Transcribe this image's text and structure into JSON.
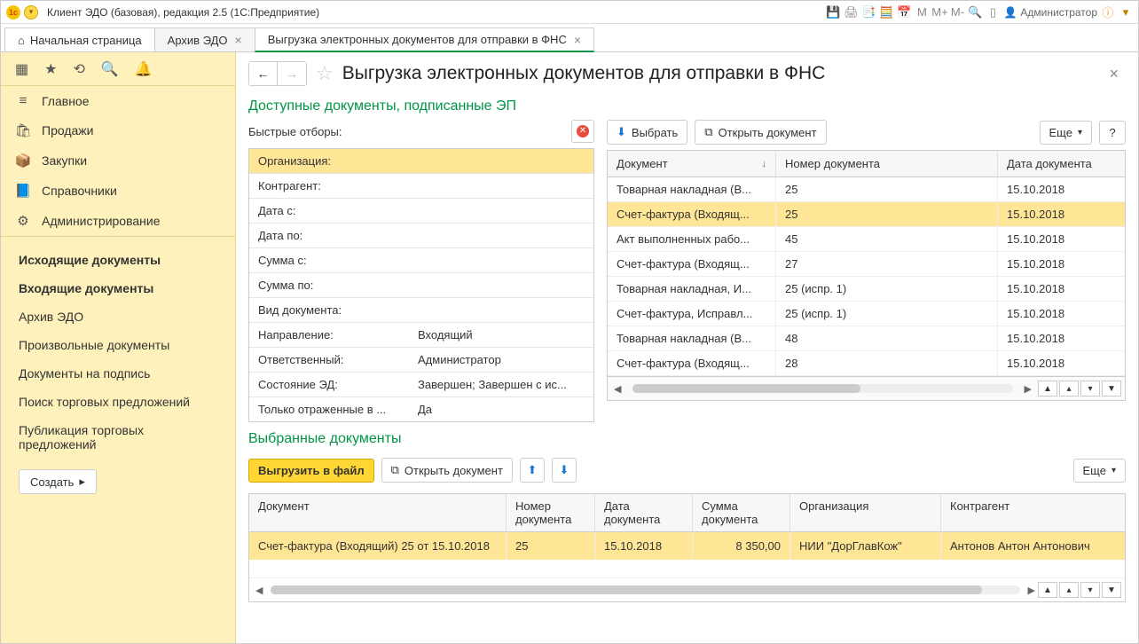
{
  "titlebar": {
    "app_label": "Клиент ЭДО (базовая), редакция 2.5  (1С:Предприятие)",
    "user": "Администратор",
    "m_buttons": [
      "M",
      "M+",
      "M-"
    ]
  },
  "tabs": {
    "home": "Начальная страница",
    "archive": "Архив ЭДО",
    "export": "Выгрузка электронных документов для отправки в ФНС"
  },
  "sidebar": {
    "main": "Главное",
    "sales": "Продажи",
    "purchases": "Закупки",
    "refs": "Справочники",
    "admin": "Администрирование",
    "links": {
      "outgoing": "Исходящие документы",
      "incoming": "Входящие документы",
      "archive": "Архив ЭДО",
      "arbitrary": "Произвольные документы",
      "tosign": "Документы на подпись",
      "search_offers": "Поиск торговых предложений",
      "publish_offers": "Публикация торговых предложений"
    },
    "create": "Создать"
  },
  "page": {
    "title": "Выгрузка электронных документов для отправки в ФНС"
  },
  "available": {
    "title": "Доступные документы, подписанные ЭП",
    "filters_label": "Быстрые отборы:",
    "filters": [
      {
        "label": "Организация:",
        "value": "",
        "selected": true
      },
      {
        "label": "Контрагент:",
        "value": ""
      },
      {
        "label": "Дата с:",
        "value": ""
      },
      {
        "label": "Дата по:",
        "value": ""
      },
      {
        "label": "Сумма с:",
        "value": ""
      },
      {
        "label": "Сумма по:",
        "value": ""
      },
      {
        "label": "Вид документа:",
        "value": ""
      },
      {
        "label": "Направление:",
        "value": "Входящий"
      },
      {
        "label": "Ответственный:",
        "value": "Администратор"
      },
      {
        "label": "Состояние ЭД:",
        "value": "Завершен; Завершен с ис..."
      },
      {
        "label": "Только отраженные в ...",
        "value": "Да"
      }
    ],
    "toolbar": {
      "select": "Выбрать",
      "open": "Открыть документ",
      "more": "Еще",
      "help": "?"
    },
    "columns": {
      "doc": "Документ",
      "num": "Номер документа",
      "date": "Дата документа"
    },
    "rows": [
      {
        "doc": "Товарная накладная (В...",
        "num": "25",
        "date": "15.10.2018"
      },
      {
        "doc": "Счет-фактура (Входящ...",
        "num": "25",
        "date": "15.10.2018",
        "selected": true
      },
      {
        "doc": "Акт выполненных рабо...",
        "num": "45",
        "date": "15.10.2018"
      },
      {
        "doc": "Счет-фактура (Входящ...",
        "num": "27",
        "date": "15.10.2018"
      },
      {
        "doc": "Товарная накладная, И...",
        "num": "25 (испр. 1)",
        "date": "15.10.2018"
      },
      {
        "doc": "Счет-фактура, Исправл...",
        "num": "25 (испр. 1)",
        "date": "15.10.2018"
      },
      {
        "doc": "Товарная накладная (В...",
        "num": "48",
        "date": "15.10.2018"
      },
      {
        "doc": "Счет-фактура (Входящ...",
        "num": "28",
        "date": "15.10.2018"
      }
    ]
  },
  "selected": {
    "title": "Выбранные документы",
    "toolbar": {
      "export": "Выгрузить в файл",
      "open": "Открыть документ",
      "more": "Еще"
    },
    "columns": {
      "doc": "Документ",
      "num": "Номер документа",
      "date": "Дата документа",
      "sum": "Сумма документа",
      "org": "Организация",
      "contr": "Контрагент"
    },
    "rows": [
      {
        "doc": "Счет-фактура (Входящий) 25 от 15.10.2018",
        "num": "25",
        "date": "15.10.2018",
        "sum": "8 350,00",
        "org": "НИИ \"ДорГлавКож\"",
        "contr": "Антонов Антон Антонович",
        "selected": true
      }
    ]
  }
}
